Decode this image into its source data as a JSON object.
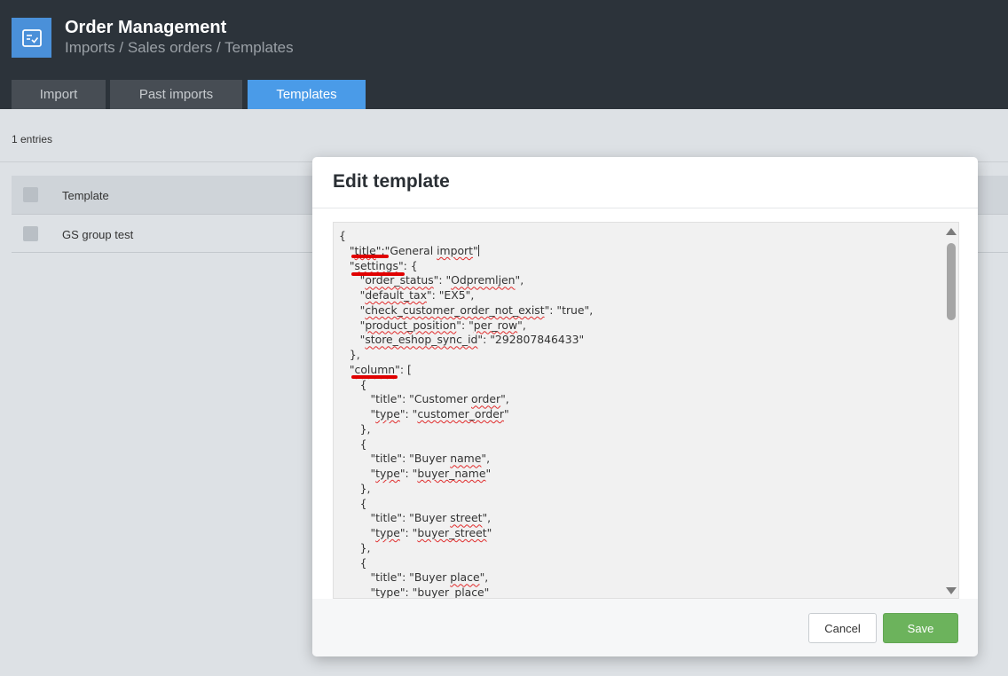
{
  "header": {
    "app_title": "Order Management",
    "breadcrumb": "Imports / Sales orders / Templates",
    "app_icon": "checklist-icon"
  },
  "tabs": [
    {
      "label": "Import",
      "active": false
    },
    {
      "label": "Past imports",
      "active": false
    },
    {
      "label": "Templates",
      "active": true
    }
  ],
  "list": {
    "entries_count": "1 entries",
    "column_template": "Template",
    "rows": [
      "GS group test"
    ]
  },
  "modal": {
    "title": "Edit template",
    "cancel_label": "Cancel",
    "save_label": "Save",
    "code_lines": [
      "{",
      "   \"title\":\"General import\"",
      "   \"settings\": {",
      "      \"order_status\": \"Odpremljen\",",
      "      \"default_tax\": \"EX5\",",
      "      \"check_customer_order_not_exist\": \"true\",",
      "      \"product_position\": \"per_row\",",
      "      \"store_eshop_sync_id\": \"292807846433\"",
      "   },",
      "   \"column\": [",
      "      {",
      "         \"title\": \"Customer order\",",
      "         \"type\": \"customer_order\"",
      "      },",
      "      {",
      "         \"title\": \"Buyer name\",",
      "         \"type\": \"buyer_name\"",
      "      },",
      "      {",
      "         \"title\": \"Buyer street\",",
      "         \"type\": \"buyer_street\"",
      "      },",
      "      {",
      "         \"title\": \"Buyer place\",",
      "         \"type\": \"buyer_place\""
    ]
  },
  "colors": {
    "topbar": "#2c333a",
    "accent": "#4a9be8",
    "save": "#6cb35c",
    "annotation": "#e00000"
  }
}
